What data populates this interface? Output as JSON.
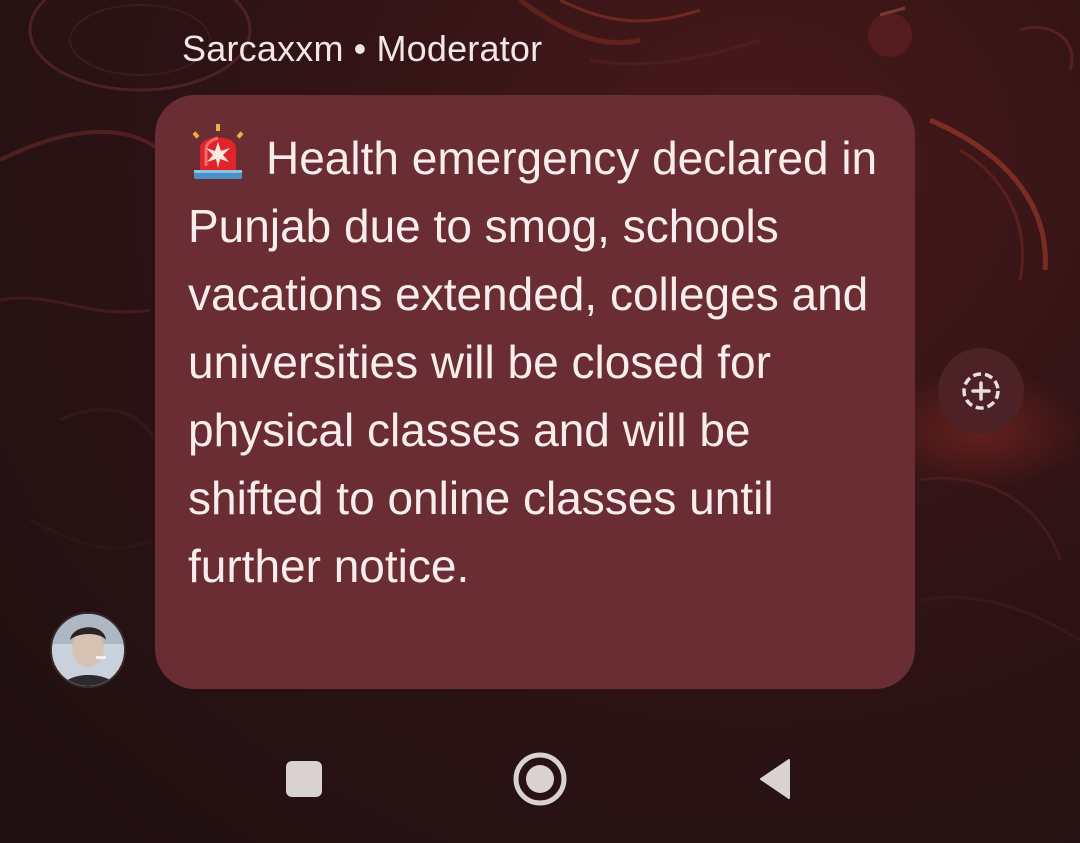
{
  "message": {
    "sender": "Sarcaxxm",
    "separator": "•",
    "role": "Moderator",
    "emoji_icon": "police-car-light-emoji",
    "text": "Health emergency declared in Punjab due to smog, schools vacations extended, colleges and universities will be closed for physical classes and will be shifted to online classes until further notice."
  },
  "reaction_button": {
    "icon": "add-reaction-icon"
  },
  "navigation": {
    "recents_icon": "square-icon",
    "home_icon": "circle-icon",
    "back_icon": "triangle-back-icon"
  },
  "colors": {
    "background": "#2a1214",
    "bubble": "#6a2d33",
    "text": "#f7eded",
    "nav_icon": "#d9d2d2"
  }
}
